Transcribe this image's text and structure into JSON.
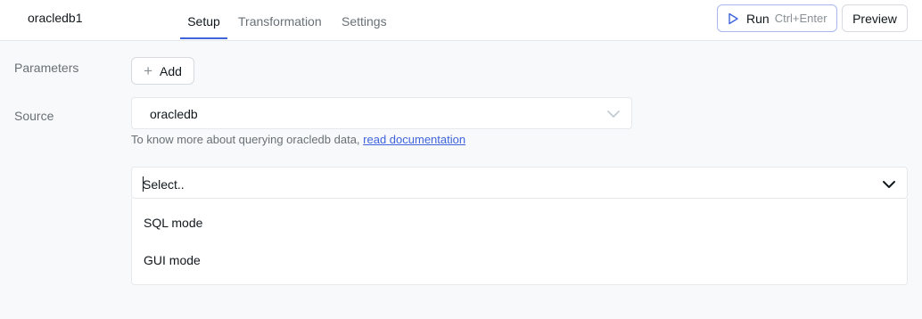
{
  "header": {
    "query_name": "oracledb1",
    "tabs": [
      {
        "label": "Setup",
        "active": true
      },
      {
        "label": "Transformation",
        "active": false
      },
      {
        "label": "Settings",
        "active": false
      }
    ],
    "run_label": "Run",
    "run_shortcut": "Ctrl+Enter",
    "preview_label": "Preview",
    "run_icon": "play-icon"
  },
  "parameters": {
    "label": "Parameters",
    "add_label": "Add",
    "add_icon": "plus-icon"
  },
  "source": {
    "label": "Source",
    "value": "oracledb",
    "hint_text": "To know more about querying oracledb data, ",
    "hint_link": "read documentation"
  },
  "mode": {
    "placeholder": "Select..",
    "options": [
      "SQL mode",
      "GUI mode"
    ]
  },
  "colors": {
    "accent": "#3e63dd",
    "muted_text": "#687076",
    "border": "#e6e8eb",
    "background": "#f8f9fa"
  }
}
